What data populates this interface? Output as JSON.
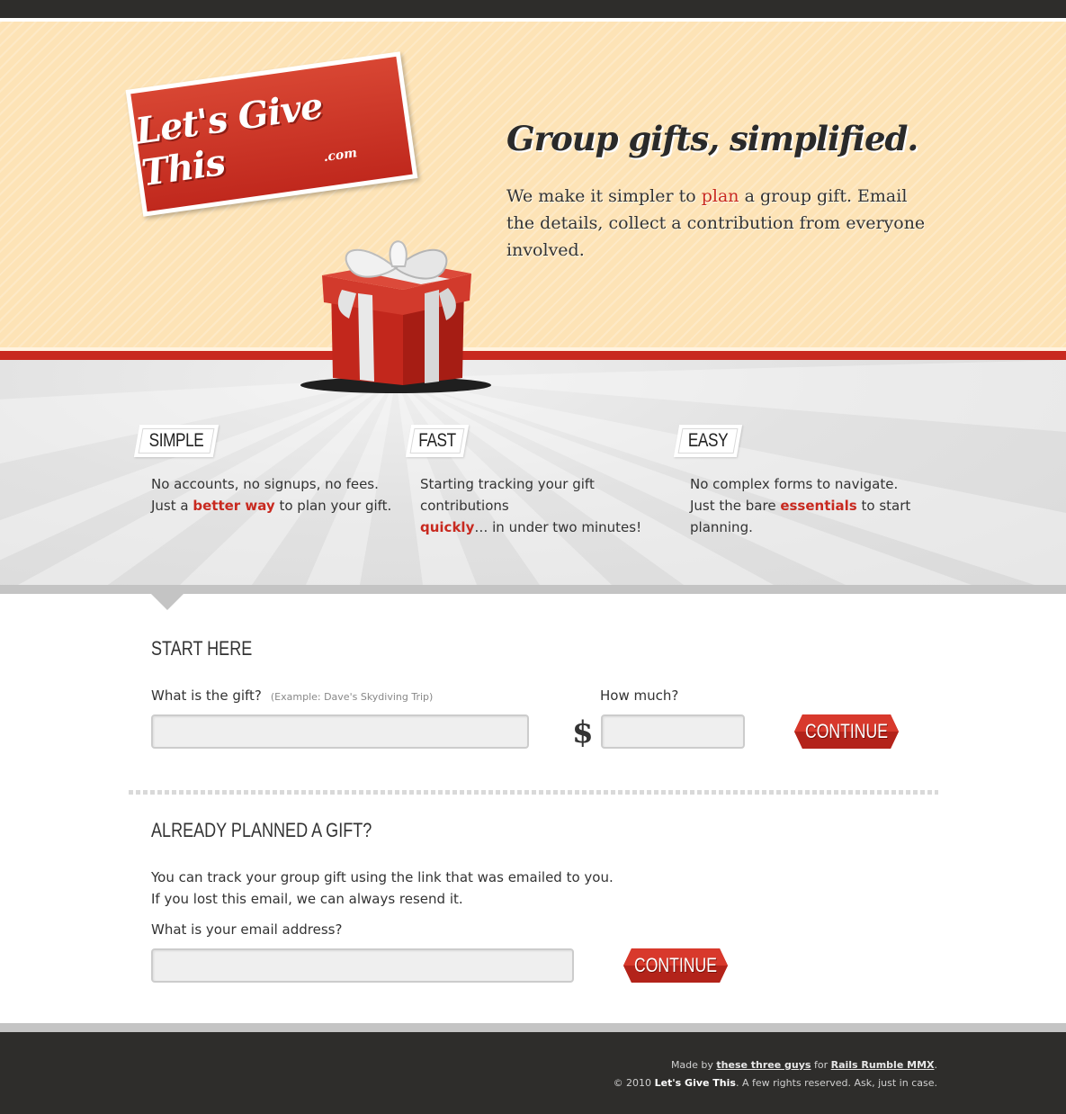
{
  "logo": {
    "text": "Let's Give This",
    "sub": ".com"
  },
  "hero": {
    "tagline": "Group gifts, simplified.",
    "intro_part1": "We make it simpler to ",
    "intro_highlight": "plan",
    "intro_part2": " a group gift. Email the details, collect a contribution from everyone involved."
  },
  "features": [
    {
      "tag": "SIMPLE",
      "line1": "No accounts, no signups, no fees.",
      "pre": "Just a ",
      "highlight": "better way",
      "post": " to plan your gift."
    },
    {
      "tag": "FAST",
      "line1": "Starting tracking your gift contributions",
      "pre": "",
      "highlight": "quickly",
      "post": "… in under two minutes!"
    },
    {
      "tag": "EASY",
      "line1": "No complex forms to navigate.",
      "pre": "Just the bare ",
      "highlight": "essentials",
      "post": " to start planning."
    }
  ],
  "start": {
    "heading": "START HERE",
    "gift_label": "What is the gift?",
    "gift_hint": "(Example: Dave's Skydiving Trip)",
    "gift_value": "",
    "amount_label": "How much?",
    "amount_value": "",
    "currency": "$",
    "continue_label": "CONTINUE"
  },
  "already": {
    "heading": "ALREADY PLANNED A GIFT?",
    "line1": "You can track your group gift using the link that was emailed to you.",
    "line2": "If you lost this email, we can always resend it.",
    "email_label": "What is your email address?",
    "email_value": "",
    "continue_label": "CONTINUE"
  },
  "footer": {
    "made_by": "Made by ",
    "link_guys": "these three guys",
    "for": " for ",
    "link_rumble": "Rails Rumble MMX",
    "period": ".",
    "copyright_pre": "© 2010 ",
    "brand": "Let's Give This",
    "copyright_post": ". A few rights reserved. Ask, just in case."
  },
  "colors": {
    "accent": "#c8291f",
    "hero_bg": "#fde3b6",
    "dark": "#2e2d2b",
    "band": "#dedede"
  }
}
